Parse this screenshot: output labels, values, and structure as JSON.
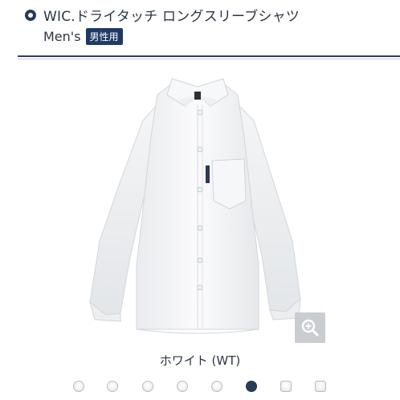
{
  "header": {
    "title": "WIC.ドライタッチ ロングスリーブシャツ",
    "subtitle": "Men's",
    "badge": "男性用"
  },
  "product": {
    "color_caption": "ホワイト (WT)"
  },
  "zoom_icon": "magnifier-plus-icon",
  "swatches": {
    "count": 9,
    "active_index": 7
  },
  "colors": {
    "accent_navy": "#253a5a",
    "badge_bg": "#1f3a66",
    "active_swatch": "#2a3c57"
  }
}
